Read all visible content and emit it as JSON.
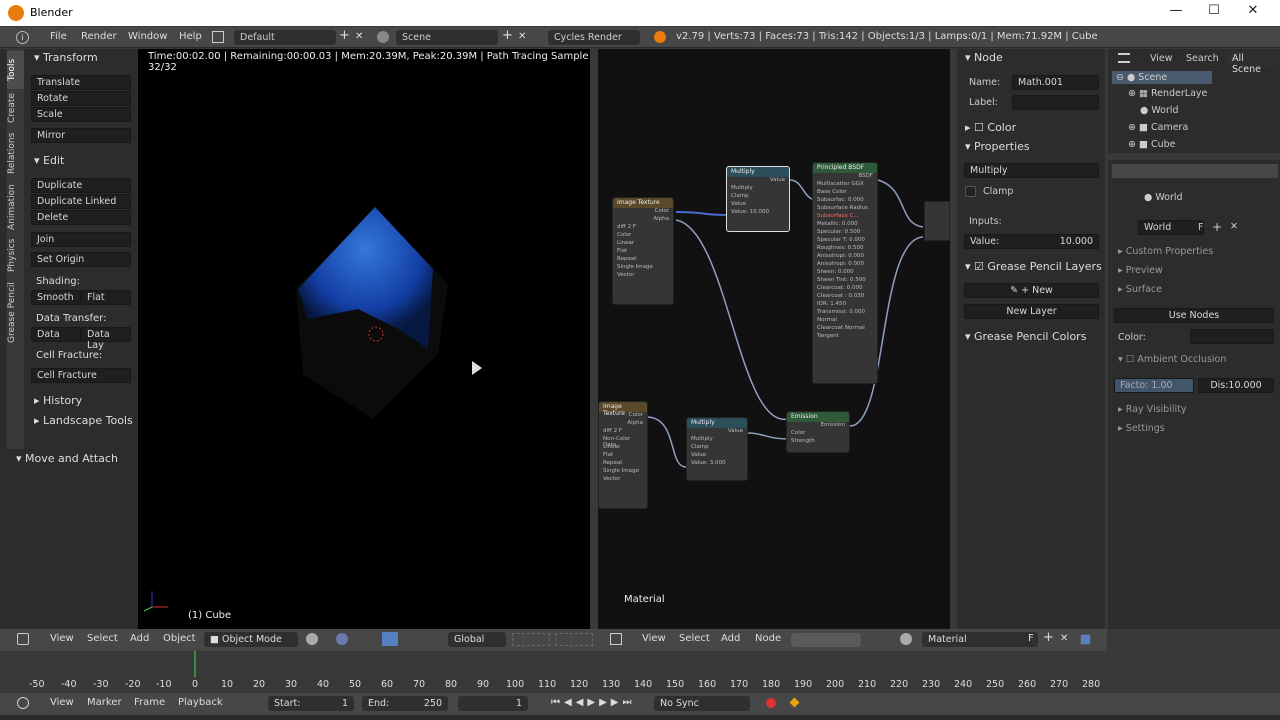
{
  "window": {
    "title": "Blender",
    "minimize": "—",
    "maximize": "☐",
    "close": "✕"
  },
  "infobar": {
    "menus": [
      "File",
      "Render",
      "Window",
      "Help"
    ],
    "layout": "Default",
    "scene": "Scene",
    "engine": "Cycles Render",
    "stats": "v2.79 | Verts:73 | Faces:73 | Tris:142 | Objects:1/3 | Lamps:0/1 | Mem:71.92M | Cube"
  },
  "viewport": {
    "render_info": "Time:00:02.00 | Remaining:00:00.03 | Mem:20.39M, Peak:20.39M | Path Tracing Sample 32/32",
    "object_label": "(1) Cube"
  },
  "toolshelf": {
    "tabs": [
      "Tools",
      "Create",
      "Relations",
      "Animation",
      "Physics",
      "Grease Pencil"
    ],
    "transform": "Transform",
    "translate": "Translate",
    "rotate": "Rotate",
    "scale": "Scale",
    "mirror": "Mirror",
    "edit": "Edit",
    "duplicate": "Duplicate",
    "duplicate_linked": "Duplicate Linked",
    "delete": "Delete",
    "join": "Join",
    "set_origin": "Set Origin",
    "shading": "Shading:",
    "smooth": "Smooth",
    "flat": "Flat",
    "data_transfer": "Data Transfer:",
    "data": "Data",
    "data_lay": "Data Lay",
    "cell_fracture_label": "Cell Fracture:",
    "cell_fracture": "Cell Fracture",
    "history": "History",
    "landscape": "Landscape Tools",
    "move_attach": "Move and Attach"
  },
  "nodeeditor": {
    "label": "Material",
    "n_multiply1": {
      "title": "Multiply",
      "out": "Value",
      "op": "Multiply",
      "clamp": "Clamp",
      "in": "Value",
      "val": "Value:   10.000"
    },
    "n_bsdf": {
      "title": "Principled BSDF",
      "out": "BSDF",
      "dist": "Multiscatter GGX",
      "ss": "Subsurface Radius",
      "rows": [
        "Base Color",
        "Subsurfac: 0.000",
        "Subsurface Radius",
        "Subsurface C...",
        "Metallic:   0.000",
        "Specular:   0.500",
        "Specular T: 0.000",
        "Roughnes: 0.500",
        "Anisotropi: 0.000",
        "Anisotropi: 0.000",
        "Sheen:   0.000",
        "Sheen Tint: 0.500",
        "Clearcoat:  0.000",
        "Clearcoat : 0.030",
        "IOR:    1.450",
        "Transmissi: 0.000",
        "Normal",
        "Clearcoat Normal",
        "Tangent"
      ]
    },
    "n_img1": {
      "title": "Image Texture",
      "color": "Color",
      "alpha": "Alpha",
      "file": "diff",
      "num": "2",
      "f": "F",
      "rows": [
        "Color",
        "Linear",
        "Flat",
        "Repeat",
        "Single Image"
      ],
      "vector": "Vector"
    },
    "n_img2": {
      "title": "Image Texture",
      "color": "Color",
      "alpha": "Alpha",
      "file": "diff",
      "num": "2",
      "f": "F",
      "rows": [
        "Non-Color Data",
        "Linear",
        "Flat",
        "Repeat",
        "Single Image"
      ],
      "vector": "Vector"
    },
    "n_multiply2": {
      "title": "Multiply",
      "out": "Value",
      "op": "Multiply",
      "clamp": "Clamp",
      "in": "Value",
      "val": "Value:   3.000"
    },
    "n_emission": {
      "title": "Emission",
      "out": "Emission",
      "color": "Color",
      "strength": "Strength"
    }
  },
  "nodeprops": {
    "node": "Node",
    "name_label": "Name:",
    "name": "Math.001",
    "label_label": "Label:",
    "color": "Color",
    "properties": "Properties",
    "op": "Multiply",
    "clamp": "Clamp",
    "inputs": "Inputs:",
    "value_label": "Value:",
    "value": "10.000",
    "gp_layers": "Grease Pencil Layers",
    "new": "New",
    "new_layer": "New Layer",
    "gp_colors": "Grease Pencil Colors"
  },
  "outliner": {
    "view": "View",
    "search": "Search",
    "all": "All Scene",
    "items": [
      "Scene",
      "RenderLaye",
      "World",
      "Camera",
      "Cube"
    ]
  },
  "props": {
    "world_crumb": "World",
    "world": "World",
    "f": "F",
    "custom": "Custom Properties",
    "preview": "Preview",
    "surface": "Surface",
    "use_nodes": "Use Nodes",
    "color": "Color:",
    "ao": "Ambient Occlusion",
    "facto": "Facto: 1.00",
    "dis": "Dis:10.000",
    "ray": "Ray Visibility",
    "settings": "Settings"
  },
  "hdr3d": {
    "menus": [
      "View",
      "Select",
      "Add",
      "Object"
    ],
    "mode": "Object Mode",
    "orient": "Global"
  },
  "hdrnode": {
    "menus": [
      "View",
      "Select",
      "Add",
      "Node"
    ],
    "material": "Material",
    "f": "F"
  },
  "timeline": {
    "ticks": [
      "-50",
      "-40",
      "-30",
      "-20",
      "-10",
      "0",
      "10",
      "20",
      "30",
      "40",
      "50",
      "60",
      "70",
      "80",
      "90",
      "100",
      "110",
      "120",
      "130",
      "140",
      "150",
      "160",
      "170",
      "180",
      "190",
      "200",
      "210",
      "220",
      "230",
      "240",
      "250",
      "260",
      "270",
      "280"
    ]
  },
  "tlhdr": {
    "menus": [
      "View",
      "Marker",
      "Frame",
      "Playback"
    ],
    "start_label": "Start:",
    "start": "1",
    "end_label": "End:",
    "end": "250",
    "current": "1",
    "sync": "No Sync"
  }
}
